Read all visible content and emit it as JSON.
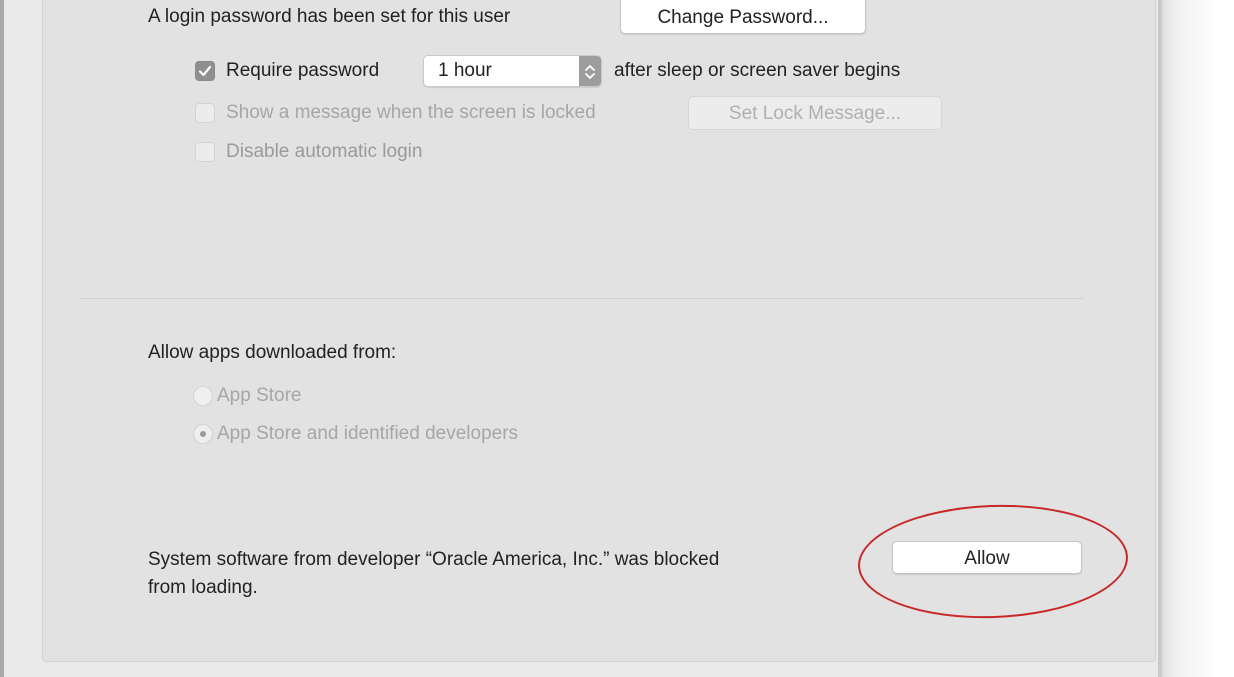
{
  "security": {
    "login_password_text": "A login password has been set for this user",
    "change_password_button": "Change Password...",
    "require_password": {
      "label": "Require password",
      "checked": true,
      "delay_value": "1 hour",
      "suffix": "after sleep or screen saver begins"
    },
    "show_message": {
      "label": "Show a message when the screen is locked",
      "checked": false,
      "enabled": false,
      "button": "Set Lock Message..."
    },
    "disable_auto_login": {
      "label": "Disable automatic login",
      "checked": false,
      "enabled": false
    }
  },
  "apps": {
    "heading": "Allow apps downloaded from:",
    "options": [
      {
        "label": "App Store",
        "selected": false
      },
      {
        "label": "App Store and identified developers",
        "selected": true
      }
    ]
  },
  "blocked": {
    "message_line1": "System software from developer “Oracle America, Inc.” was blocked",
    "message_line2": "from loading.",
    "allow_button": "Allow"
  },
  "colors": {
    "panel_bg": "#e2e2e2",
    "highlight": "#c8282a",
    "checkbox_checked": "#8f8f8f"
  }
}
